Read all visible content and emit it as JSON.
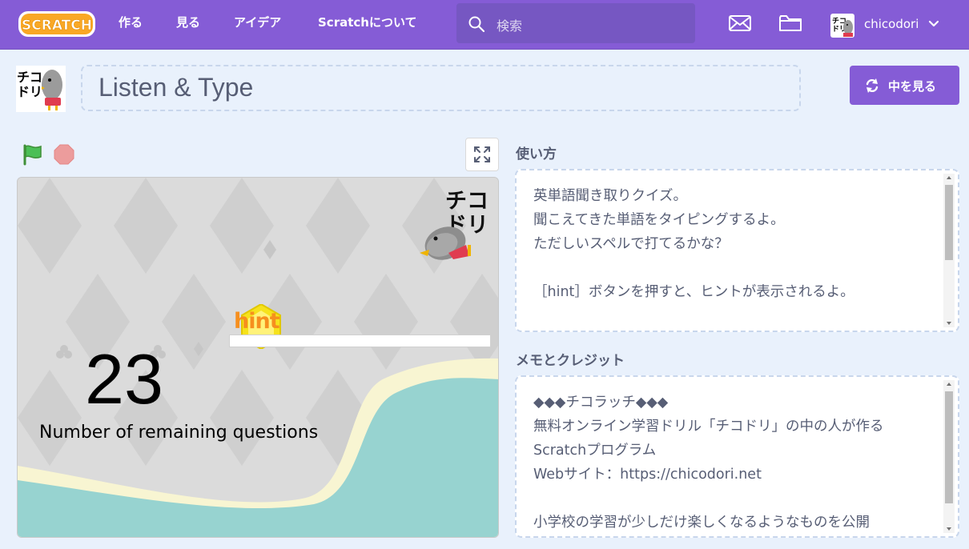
{
  "nav": {
    "logo": "SCRATCH",
    "links": [
      "作る",
      "見る",
      "アイデア",
      "Scratchについて"
    ],
    "search_placeholder": "検索",
    "username": "chicodori"
  },
  "project": {
    "title": "Listen & Type",
    "see_inside_label": "中を見る",
    "avatar_text": "チコドリ"
  },
  "stage": {
    "logo_text_line1": "チコ",
    "logo_text_line2": "ドリ",
    "hint_label": "hint",
    "remaining_count": "23",
    "remaining_label": "Number of remaining questions"
  },
  "instructions": {
    "heading": "使い方",
    "text": "英単語聞き取りクイズ。\n聞こえてきた単語をタイピングするよ。\nただしいスペルで打てるかな？\n\n［hint］ボタンを押すと、ヒントが表示されるよ。"
  },
  "notes": {
    "heading": "メモとクレジット",
    "text": "◆◆◆チコラッチ◆◆◆\n無料オンライン学習ドリル「チコドリ」の中の人が作るScratchプログラム\nWebサイト：https://chicodori.net\n\n小学校の学習が少しだけ楽しくなるようなものを公開"
  },
  "colors": {
    "nav_bg": "#855cd6",
    "page_bg": "#e9f1fc",
    "stage_water": "#97d3d0",
    "stage_cream": "#f9f6d4",
    "hint_orange": "#f68f1e"
  }
}
